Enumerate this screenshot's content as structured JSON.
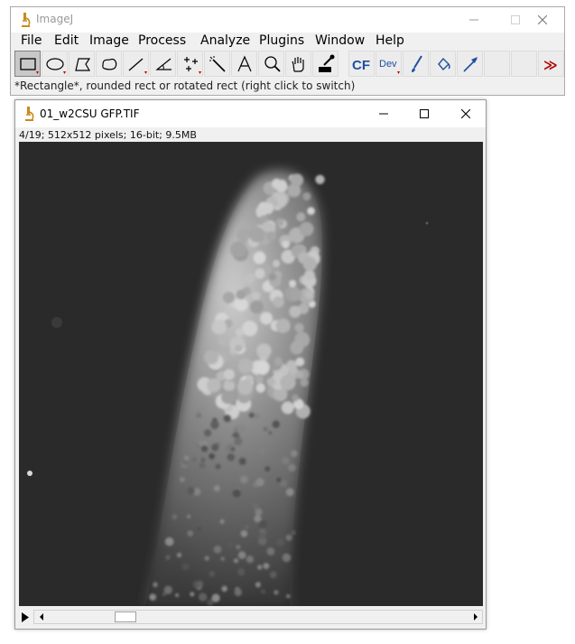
{
  "main_window": {
    "title": "ImageJ",
    "menus": [
      "File",
      "Edit",
      "Image",
      "Process",
      "Analyze",
      "Plugins",
      "Window",
      "Help"
    ],
    "tools": [
      {
        "icon": "rectangle-icon",
        "selected": true
      },
      {
        "icon": "oval-icon"
      },
      {
        "icon": "polygon-icon"
      },
      {
        "icon": "freehand-icon"
      },
      {
        "icon": "line-icon"
      },
      {
        "icon": "angle-icon"
      },
      {
        "icon": "multipoint-icon"
      },
      {
        "icon": "wand-icon"
      },
      {
        "icon": "text-icon"
      },
      {
        "icon": "magnifier-icon"
      },
      {
        "icon": "hand-icon"
      },
      {
        "icon": "color-picker-icon"
      },
      {
        "icon": "cf-icon",
        "label": "CF"
      },
      {
        "icon": "dev-icon",
        "label": "Dev"
      },
      {
        "icon": "brush-icon"
      },
      {
        "icon": "flood-fill-icon"
      },
      {
        "icon": "arrow-icon"
      },
      {
        "icon": "empty-slot"
      },
      {
        "icon": "empty-slot"
      },
      {
        "icon": "more-tools-icon",
        "label": "≫"
      }
    ],
    "status": "*Rectangle*, rounded rect or rotated rect (right click to switch)"
  },
  "image_window": {
    "title": "01_w2CSU GFP.TIF",
    "info": "4/19; 512x512 pixels; 16-bit; 9.5MB",
    "slice": 4,
    "slice_count": 19
  },
  "colors": {
    "toolbar_bg": "#f0f0f0",
    "canvas_bg": "#262626",
    "accent_blue": "#1f4f9f",
    "accent_red": "#b00000"
  }
}
